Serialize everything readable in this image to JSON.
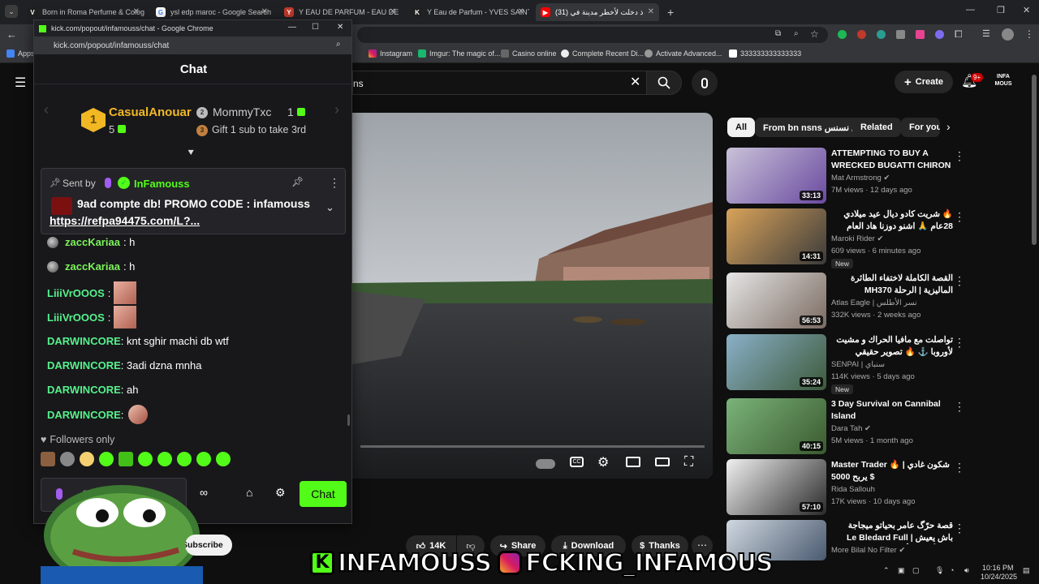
{
  "tabs": [
    {
      "label": "Born in Roma Perfume & Colog",
      "fav_color": "#1f1f1f",
      "fav": "V"
    },
    {
      "label": "ysl edp maroc - Google Search",
      "fav_color": "#ffffff",
      "fav": "G"
    },
    {
      "label": "Y EAU DE PARFUM - EAU DE PA",
      "fav_color": "#c0392b",
      "fav": "Y"
    },
    {
      "label": "Y Eau de Parfum - YVES SAINT L",
      "fav_color": "#1f1f1f",
      "fav": "K"
    },
    {
      "label": "(31) ذ دخلت لأخطر مدينة في",
      "fav_color": "#ff0000",
      "fav": "▶"
    }
  ],
  "bookmarks": [
    {
      "label": "Apps"
    },
    {
      "label": "Instagram"
    },
    {
      "label": "Imgur: The magic of..."
    },
    {
      "label": "Casino online"
    },
    {
      "label": "Complete Recent Di..."
    },
    {
      "label": "Activate Advanced..."
    },
    {
      "label": "333333333333333"
    }
  ],
  "kick": {
    "window_title": "kick.com/popout/infamouss/chat - Google Chrome",
    "url": "kick.com/popout/infamouss/chat",
    "chat_title": "Chat",
    "leader1": {
      "rank": "1",
      "name": "CasualAnouar",
      "count": "5"
    },
    "leader2": {
      "rank": "2",
      "name": "MommyTxc",
      "count": "1"
    },
    "leader3": {
      "rank": "3",
      "text": "Gift 1 sub to take 3rd"
    },
    "pinned": {
      "sent_by": "Sent by",
      "author": "InFamouss",
      "text": "9ad compte db! PROMO CODE : infamouss",
      "link": "https://refpa94475.com/L?..."
    },
    "messages": [
      {
        "user": "zaccKariaa",
        "text": ": h"
      },
      {
        "user": "zaccKariaa",
        "text": ": h"
      },
      {
        "user": "LiiiVrOOOS",
        "text": ":"
      },
      {
        "user": "LiiiVrOOOS",
        "text": ":"
      },
      {
        "user": "DARWINCORE",
        "text": ": knt sghir machi db wtf"
      },
      {
        "user": "DARWINCORE",
        "text": ": 3adi dzna mnha"
      },
      {
        "user": "DARWINCORE",
        "text": ": ah"
      },
      {
        "user": "DARWINCORE",
        "text": ":"
      }
    ],
    "followers_only": "Followers only",
    "input_placeholder": "S",
    "chat_button": "Chat"
  },
  "youtube": {
    "search_text": "ns",
    "create_label": "Create",
    "notif_count": "9+",
    "chips": [
      "All",
      "From bn nsns بن نسنس",
      "Related",
      "For you"
    ],
    "actions": {
      "likes": "14K",
      "share": "Share",
      "download": "Download",
      "thanks": "Thanks"
    },
    "subscribe": "Subscribe",
    "recs": [
      {
        "title": "ATTEMPTING TO BUY A WRECKED BUGATTI CHIRON ...",
        "channel": "Mat Armstrong",
        "verified": true,
        "meta": "7M views · 12 days ago",
        "dur": "33:13",
        "new": "",
        "c1": "#c9c2d8",
        "c2": "#6a4aa0"
      },
      {
        "title": "🔥 شريت كادو ديال عيد ميلادي 28عام 🙏 اشنو دوزنا هاد العام",
        "channel": "Maroki Rider",
        "verified": true,
        "meta": "609 views · 6 minutes ago",
        "dur": "14:31",
        "new": "New",
        "c1": "#d9a35a",
        "c2": "#3b3b3b"
      },
      {
        "title": "القصة الكاملة لاختفاء الطائرة الماليزية | الرحلة MH370",
        "channel": "Atlas Eagle | نسر الأطلس",
        "verified": false,
        "meta": "332K views · 2 weeks ago",
        "dur": "56:53",
        "new": "",
        "c1": "#e6e6e6",
        "c2": "#7a6a60"
      },
      {
        "title": "تواصلت مع مافيا الحراك و مشيت لأوروبا ⚓ 🔥 تصوير حقيقي",
        "channel": "SENPAI | سنباي",
        "verified": false,
        "meta": "114K views · 5 days ago",
        "dur": "35:24",
        "new": "New",
        "c1": "#8ab0c8",
        "c2": "#3d5a3a"
      },
      {
        "title": "3 Day Survival on Cannibal Island",
        "channel": "Dara Tah",
        "verified": true,
        "meta": "5M views · 1 month ago",
        "dur": "40:15",
        "new": "",
        "c1": "#7bb37a",
        "c2": "#3a5a2f"
      },
      {
        "title": "Master Trader 🔥 | شكون غادي يربح 5000 $",
        "channel": "Rida Sallouh",
        "verified": false,
        "meta": "17K views · 10 days ago",
        "dur": "57:10",
        "new": "",
        "c1": "#f0f0f0",
        "c2": "#2a2a2a"
      },
      {
        "title": "قصة حرّگ عامر بحياتو ميجاجة باش يعيش | Le Bledard Full حياة أفضل فأوروبا",
        "channel": "More Bilal No Filter",
        "verified": true,
        "meta": "",
        "dur": "",
        "new": "",
        "c1": "#d0d8e0",
        "c2": "#4a5a70"
      }
    ]
  },
  "overlay": {
    "kick_handle": "INFAMOUSS",
    "ig_handle": "FCKING_INFAMOUS"
  },
  "taskbar": {
    "time": "10:16 PM",
    "date": "10/24/2025"
  }
}
